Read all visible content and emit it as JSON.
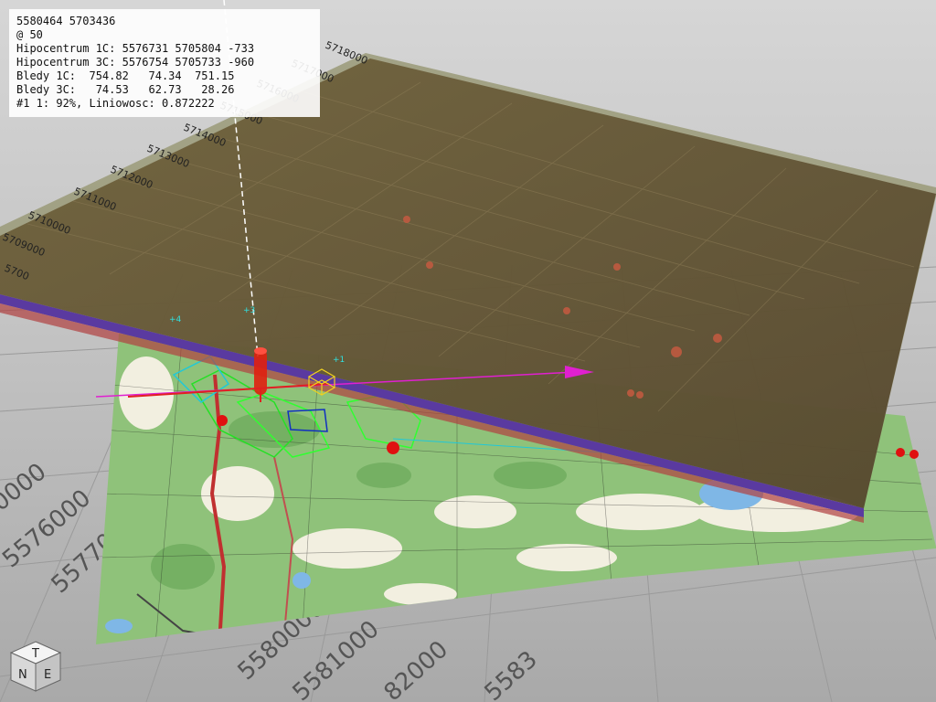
{
  "hud": {
    "lines": [
      "5580464 5703436",
      "@ 50",
      "Hipocentrum 1C: 5576731 5705804 -733",
      "Hipocentrum 3C: 5576754 5705733 -960",
      "Bledy 1C:  754.82   74.34  751.15",
      "Bledy 3C:   74.53   62.73   28.26",
      "#1 1: 92%, Liniowosc: 0.872222"
    ]
  },
  "ground_axis_labels": [
    "0000",
    "5576000",
    "5577000",
    "5580000",
    "5581000",
    "82000",
    "5583"
  ],
  "tilted_axis_labels": [
    "5700",
    "5709000",
    "5710000",
    "5711000",
    "5712000",
    "5713000",
    "5714000",
    "5715000",
    "5716000",
    "5717000",
    "5718000"
  ],
  "nav_cube": {
    "top": "T",
    "left": "N",
    "right": "E"
  },
  "colors": {
    "background": "#c8c8c8",
    "tilted_plane": "#5a4a2a",
    "tilted_edge": "#9a9a78",
    "plane_underside": "#5a3aa0",
    "map_green": "#8fc27a",
    "event_red": "#e01010",
    "vector_magenta": "#e020d0"
  },
  "markers": [
    "+4",
    "+3",
    "+1"
  ]
}
